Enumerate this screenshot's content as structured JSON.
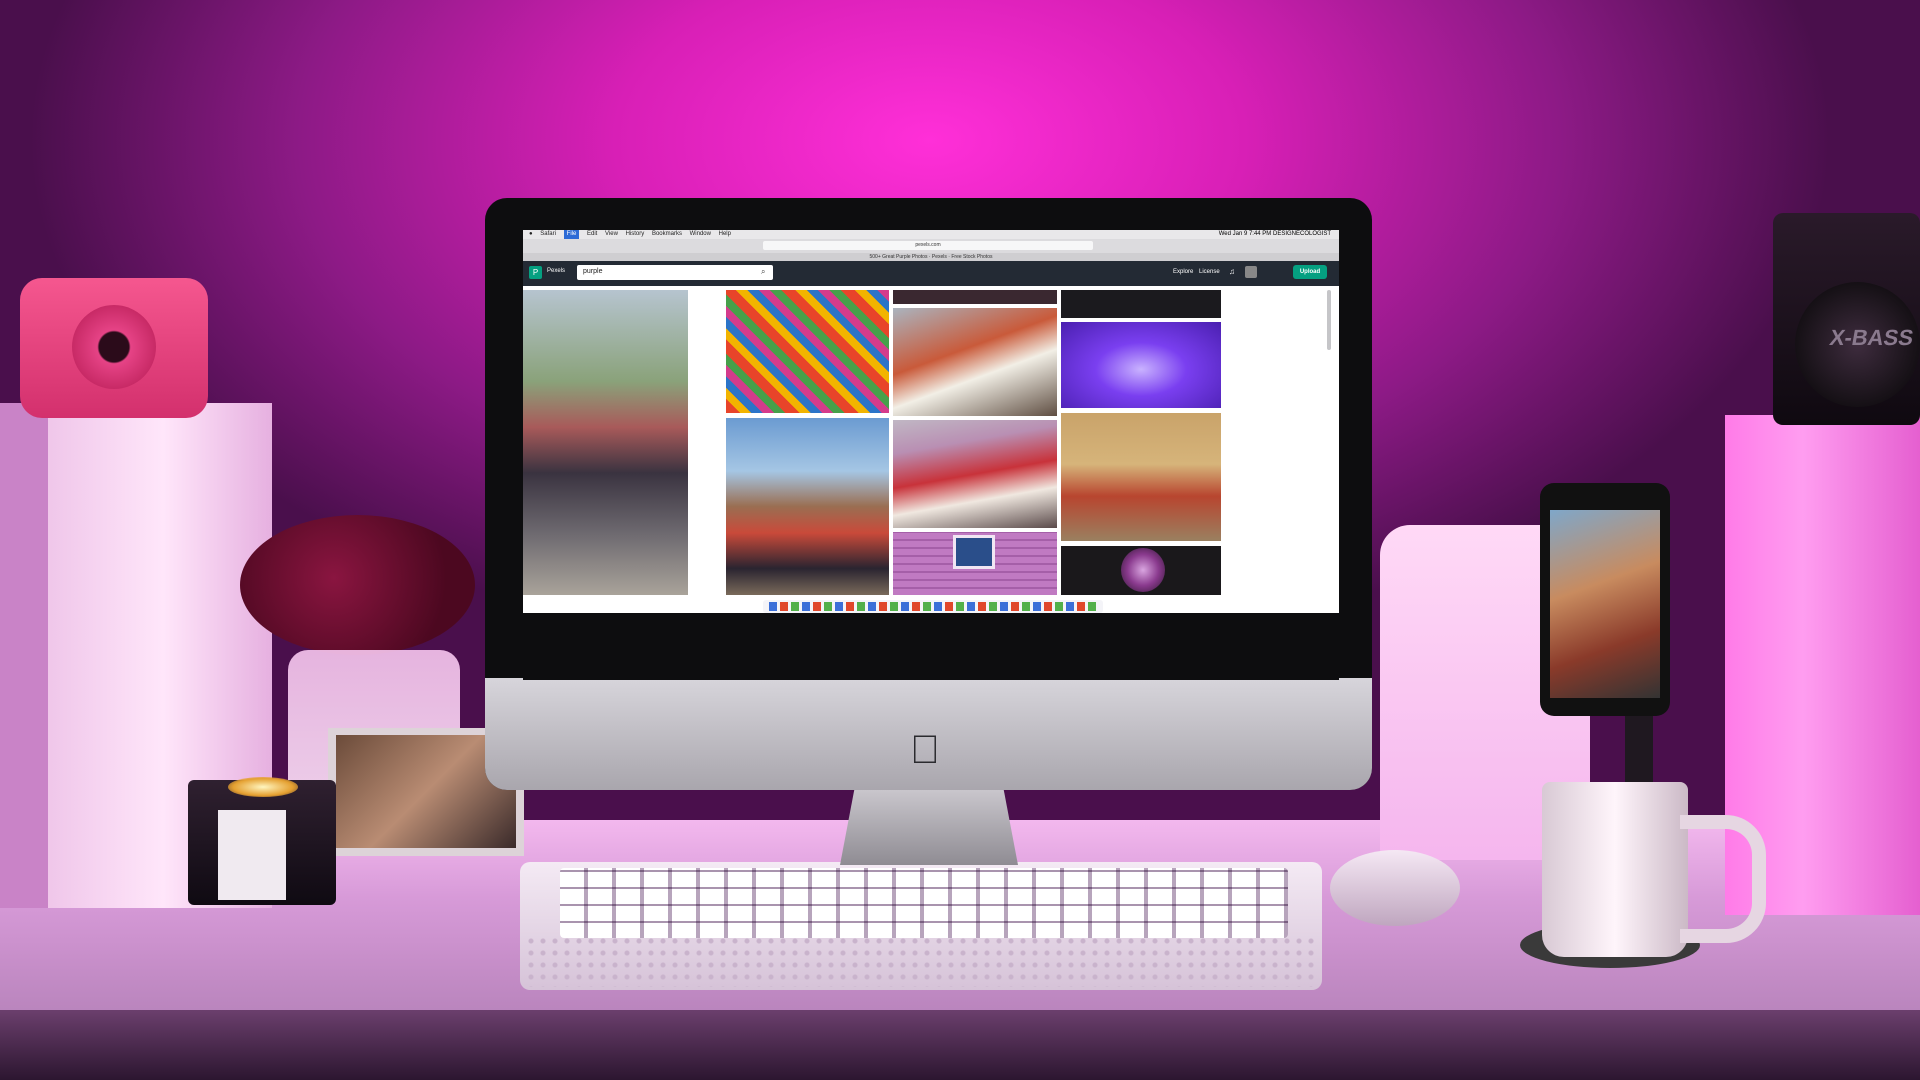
{
  "scene": {
    "speaker_label": "X-BASS"
  },
  "browser": {
    "menu": [
      "Safari",
      "File",
      "Edit",
      "View",
      "History",
      "Bookmarks",
      "Window",
      "Help"
    ],
    "active_menu_index": 1,
    "clock": "Wed Jan 9  7:44 PM",
    "user": "DESIGNECOLOGIST",
    "url": "pexels.com",
    "tab_title": "500+ Great Purple Photos · Pexels · Free Stock Photos"
  },
  "site": {
    "logo_letter": "P",
    "brand": "Pexels",
    "search_value": "purple",
    "nav_explore": "Explore",
    "nav_license": "License",
    "upload_label": "Upload",
    "accent_color": "#05a081"
  },
  "icons": {
    "search": "search-icon",
    "bell": "bell-icon",
    "apple": "apple-logo-icon"
  }
}
